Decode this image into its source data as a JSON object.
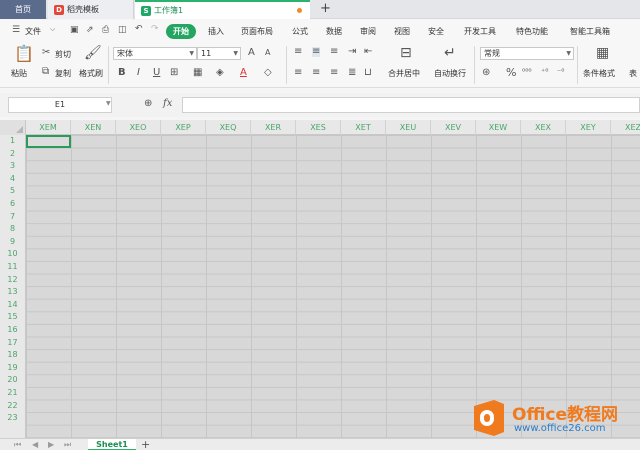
{
  "tabs": {
    "home": "首页",
    "template": "稻壳模板",
    "active": "工作簿1",
    "add": "+"
  },
  "menu": {
    "file": "文件",
    "start": "开始",
    "items": [
      "插入",
      "页面布局",
      "公式",
      "数据",
      "审阅",
      "视图",
      "安全",
      "开发工具",
      "特色功能",
      "智能工具箱"
    ]
  },
  "ribbon": {
    "paste": "粘贴",
    "cut": "剪切",
    "copy": "复制",
    "format_painter": "格式刷",
    "font_name": "宋体",
    "font_size": "11",
    "merge_center": "合并居中",
    "wrap_text": "自动换行",
    "number_format": "常规",
    "conditional_format": "条件格式",
    "table_style": "表"
  },
  "formula_bar": {
    "name_box": "E1",
    "fx_label": "fx",
    "value": ""
  },
  "grid": {
    "columns": [
      "XEM",
      "XEN",
      "XEO",
      "XEP",
      "XEQ",
      "XER",
      "XES",
      "XET",
      "XEU",
      "XEV",
      "XEW",
      "XEX",
      "XEY",
      "XEZ"
    ],
    "rows": [
      "1",
      "2",
      "3",
      "4",
      "5",
      "6",
      "7",
      "8",
      "9",
      "10",
      "11",
      "12",
      "13",
      "14",
      "15",
      "16",
      "17",
      "18",
      "19",
      "20",
      "21",
      "22",
      "23"
    ]
  },
  "sheets": {
    "active": "Sheet1",
    "add": "+"
  },
  "watermark": {
    "title": "Office教程网",
    "url": "www.office26.com"
  },
  "colors": {
    "accent": "#24a562",
    "header_text": "#4aa56a",
    "watermark_orange": "#f07a1e",
    "watermark_blue": "#2a7cc7"
  }
}
